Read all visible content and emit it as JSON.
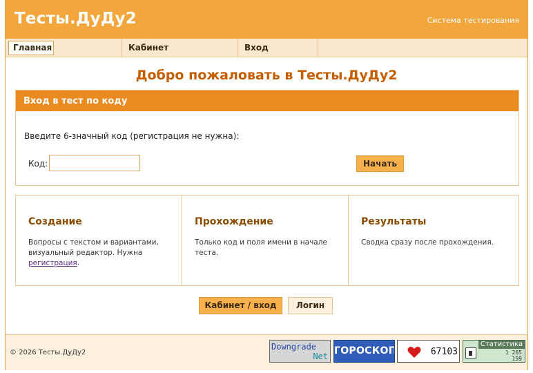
{
  "header": {
    "site_title": "Тесты.ДуДу2",
    "subtitle": "Система тестирования"
  },
  "nav": {
    "items": [
      {
        "label": "Главная",
        "active": true
      },
      {
        "label": "Кабинет",
        "active": false
      },
      {
        "label": "Вход",
        "active": false
      }
    ]
  },
  "main": {
    "title": "Добро пожаловать в Тесты.ДуДу2",
    "code_panel": {
      "heading": "Вход в тест по коду",
      "prompt": "Введите 6-значный код (регистрация не нужна):",
      "code_label": "Код:",
      "code_value": "",
      "code_placeholder": "",
      "start_label": "Начать"
    },
    "features": [
      {
        "title": "Создание",
        "text": "Вопросы с текстом и вариантами, визуальный редактор. Нужна",
        "link": "регистрация",
        "after_link": "."
      },
      {
        "title": "Прохождение",
        "text": "Только код и поля имени в начале теста."
      },
      {
        "title": "Результаты",
        "text": "Сводка сразу после прохождения."
      }
    ],
    "cabinet_button": "Кабинет / вход",
    "login_button": "Логин"
  },
  "footer": {
    "copyright": "© 2026 Тесты.ДуДу2",
    "badges": {
      "downgrade_line1": "Downgrade",
      "downgrade_line2": "Net",
      "horoscope": "ГОРОСКОПЫ",
      "counter_value": "67103",
      "stats_title": "Статистика",
      "stats_total": "1 265",
      "stats_today": "159"
    }
  },
  "colors": {
    "header_orange": "#f3a63c",
    "panel_head_orange": "#e98b21",
    "title_brown": "#c45e00",
    "nav_bg": "#fbe9cf"
  }
}
